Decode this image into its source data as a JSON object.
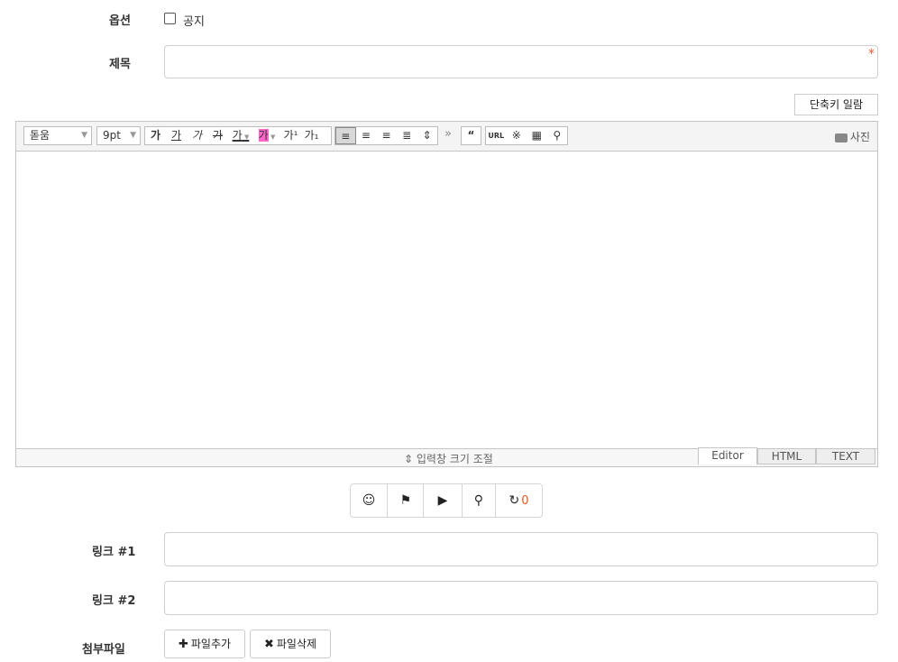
{
  "options": {
    "label": "옵션",
    "notice_label": "공지",
    "notice_checked": false
  },
  "title_field": {
    "label": "제목",
    "value": "",
    "required_mark": "*"
  },
  "shortcut_button": "단축키 일람",
  "toolbar": {
    "font_family": "돋움",
    "font_size": "9pt",
    "format_buttons": [
      "가",
      "가",
      "가",
      "가",
      "가"
    ],
    "color_button": "가",
    "sup_button": "가¹",
    "sub_button": "가₁",
    "more": "»",
    "quote": "“",
    "url": "URL",
    "special": "※",
    "photo_label": "사진"
  },
  "resize_label": "입력창 크기 조절",
  "mode_tabs": [
    "Editor",
    "HTML",
    "TEXT"
  ],
  "media": {
    "refresh_count": "0"
  },
  "link1": {
    "label": "링크 #1",
    "value": ""
  },
  "link2": {
    "label": "링크 #2",
    "value": ""
  },
  "attachments": {
    "label": "첨부파일",
    "add_label": "파일추가",
    "delete_label": "파일삭제"
  },
  "colors": {
    "accent": "#e8591c",
    "required": "#ee5533"
  }
}
